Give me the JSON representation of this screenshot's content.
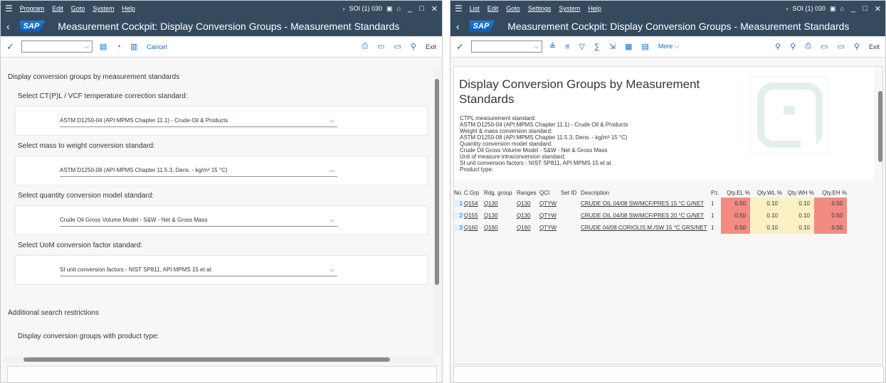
{
  "left": {
    "menu": [
      "Program",
      "Edit",
      "Goto",
      "System",
      "Help"
    ],
    "system_id": "SOI (1) 030",
    "title": "Measurement Cockpit: Display Conversion Groups - Measurement Standards",
    "sap_logo": "SAP",
    "cancel_label": "Cancel",
    "exit_label": "Exit",
    "section1_title": "Display conversion groups by measurement standards",
    "fields": [
      {
        "label": "Select CT(P)L / VCF temperature correction standard:",
        "value": "ASTM D1250-04 (API MPMS Chapter 11.1) - Crude Oil & Products"
      },
      {
        "label": "Select mass to weight conversion standard:",
        "value": "ASTM D1250-08 (API MPMS Chapter 11.5.3, Dens. - kg/m³ 15 °C)"
      },
      {
        "label": "Select quantity conversion model standard:",
        "value": "Crude Oil Gross Volume Model - S&W - Net & Gross Mass"
      },
      {
        "label": "Select UoM conversion factor standard:",
        "value": "SI unit conversion factors - NIST SP811, API MPMS 15 et al."
      }
    ],
    "section2_title": "Additional search restrictions",
    "section2_label": "Display conversion groups with product type:"
  },
  "right": {
    "menu": [
      "List",
      "Edit",
      "Goto",
      "Settings",
      "System",
      "Help"
    ],
    "system_id": "SOI (1) 030",
    "title": "Measurement Cockpit: Display Conversion Groups - Measurement Standards",
    "sap_logo": "SAP",
    "more_label": "More",
    "exit_label": "Exit",
    "heading": "Display Conversion Groups by Measurement Standards",
    "info_lines": [
      "CTPL measurement standard:",
      "ASTM D1250-04 (API MPMS Chapter 11.1) - Crude Oil & Products",
      "Weight & mass conversion standard:",
      "ASTM D1250-08 (API MPMS Chapter 11.5.3, Dens. - kg/m³ 15 °C)",
      "Quantity conversion model standard:",
      "Crude Oil Gross Volume Model - S&W - Net & Gross Mass",
      "Unit of measure intraconversion standard:",
      "SI unit conversion factors - NIST SP811, API MPMS 15 et al.",
      "Product type:"
    ],
    "columns": [
      "No",
      "C.Grp",
      "Rdg. group",
      "Ranges",
      "QCI",
      "Set ID",
      "Description",
      "P.t.",
      "Qty.EL %",
      "Qty.WL %",
      "Qty WH %",
      "Qty.EH %"
    ],
    "rows": [
      [
        "1",
        "Q154",
        "Q130",
        "Q130",
        "QTYW",
        "",
        "CRUDE OIL 04/08 SW/MCF/PRES 15 °C G/NET",
        "1",
        "0.50",
        "0.10",
        "0.10",
        "0.50"
      ],
      [
        "2",
        "Q155",
        "Q130",
        "Q130",
        "QTYW",
        "",
        "CRUDE OIL 04/08 SW/MCF/PRES 20 °C G/NET",
        "1",
        "0.50",
        "0.10",
        "0.10",
        "0.50"
      ],
      [
        "3",
        "Q160",
        "Q160",
        "Q160",
        "QTYW",
        "",
        "CRUDE 04/08 CORIOLIS M./SW 15 °C GRS/NET",
        "1",
        "0.50",
        "0.10",
        "0.10",
        "0.50"
      ]
    ],
    "colors": {
      "limit_red": "#f28b82",
      "limit_yellow": "#fbf1c4"
    }
  },
  "colors": {
    "shell": "#354a5f",
    "accent": "#0a6ed1",
    "ok_green": "#107e3e"
  }
}
